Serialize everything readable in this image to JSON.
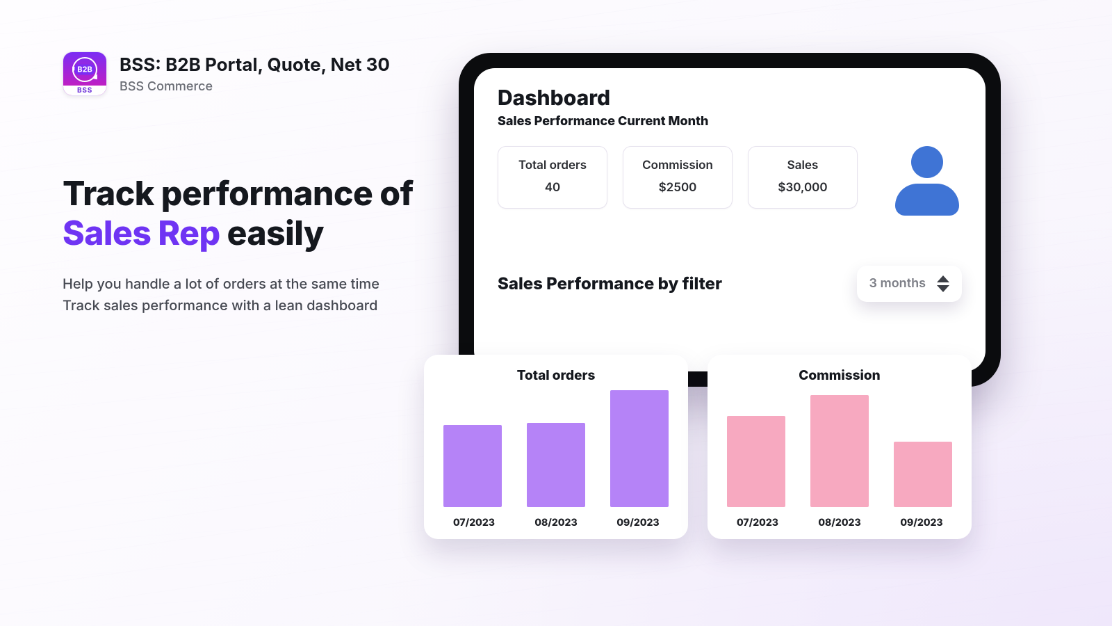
{
  "header": {
    "app_title": "BSS: B2B Portal, Quote, Net 30",
    "vendor": "BSS Commerce",
    "logo_footer": "BSS",
    "logo_b2b": "B2B"
  },
  "hero": {
    "line1": "Track performance of",
    "accent": "Sales Rep",
    "line2_rest": " easily",
    "body_line1": "Help you handle a lot of orders at the same time",
    "body_line2": "Track sales performance with a lean dashboard"
  },
  "dashboard": {
    "title": "Dashboard",
    "subtitle": "Sales Performance Current Month",
    "metrics": [
      {
        "label": "Total orders",
        "value": "40"
      },
      {
        "label": "Commission",
        "value": "$2500"
      },
      {
        "label": "Sales",
        "value": "$30,000"
      }
    ],
    "filter_title": "Sales Performance by filter",
    "dropdown": {
      "selected": "3 months"
    }
  },
  "chart_data": [
    {
      "id": "total_orders",
      "type": "bar",
      "title": "Total orders",
      "categories": [
        "07/2023",
        "08/2023",
        "09/2023"
      ],
      "values": [
        70,
        72,
        100
      ],
      "ylim": [
        0,
        100
      ],
      "color": "#b583f7",
      "note": "values estimated from relative bar heights; no y-axis ticks shown"
    },
    {
      "id": "commission",
      "type": "bar",
      "title": "Commission",
      "categories": [
        "07/2023",
        "08/2023",
        "09/2023"
      ],
      "values": [
        78,
        96,
        56
      ],
      "ylim": [
        0,
        100
      ],
      "color": "#f7a9c0",
      "note": "values estimated from relative bar heights; no y-axis ticks shown"
    }
  ]
}
